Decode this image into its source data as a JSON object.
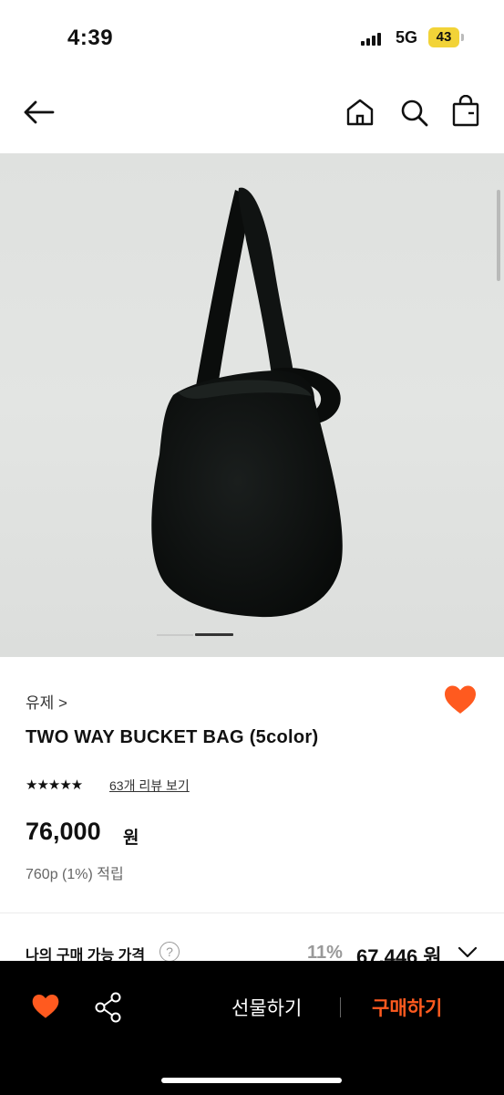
{
  "status_bar": {
    "time": "4:39",
    "network": "5G",
    "battery": "43"
  },
  "nav": {
    "icons": [
      "back-arrow-icon",
      "home-icon",
      "search-icon",
      "shopping-bag-icon"
    ]
  },
  "product": {
    "image": "black-bucket-bag-photo",
    "image_count_indicator": "image-pager",
    "brand": "유제 >",
    "title": "TWO WAY BUCKET BAG (5color)",
    "rating_stars": "★★★★★",
    "review_link": "63개 리뷰 보기",
    "price": "76,000",
    "price_unit": "원",
    "points": "760p (1%) 적립",
    "wishlisted": true
  },
  "my_price": {
    "label": "나의 구매 가능 가격",
    "help": "?",
    "discount_rate": "11%",
    "discount_price": "67,446 원"
  },
  "bottom_bar": {
    "gift_label": "선물하기",
    "buy_label": "구매하기",
    "icons": [
      "heart-icon",
      "share-icon"
    ]
  },
  "colors": {
    "accent": "#ff5a1f",
    "bottom_bar_bg": "#000000",
    "image_bg": "#e0e2e0"
  }
}
